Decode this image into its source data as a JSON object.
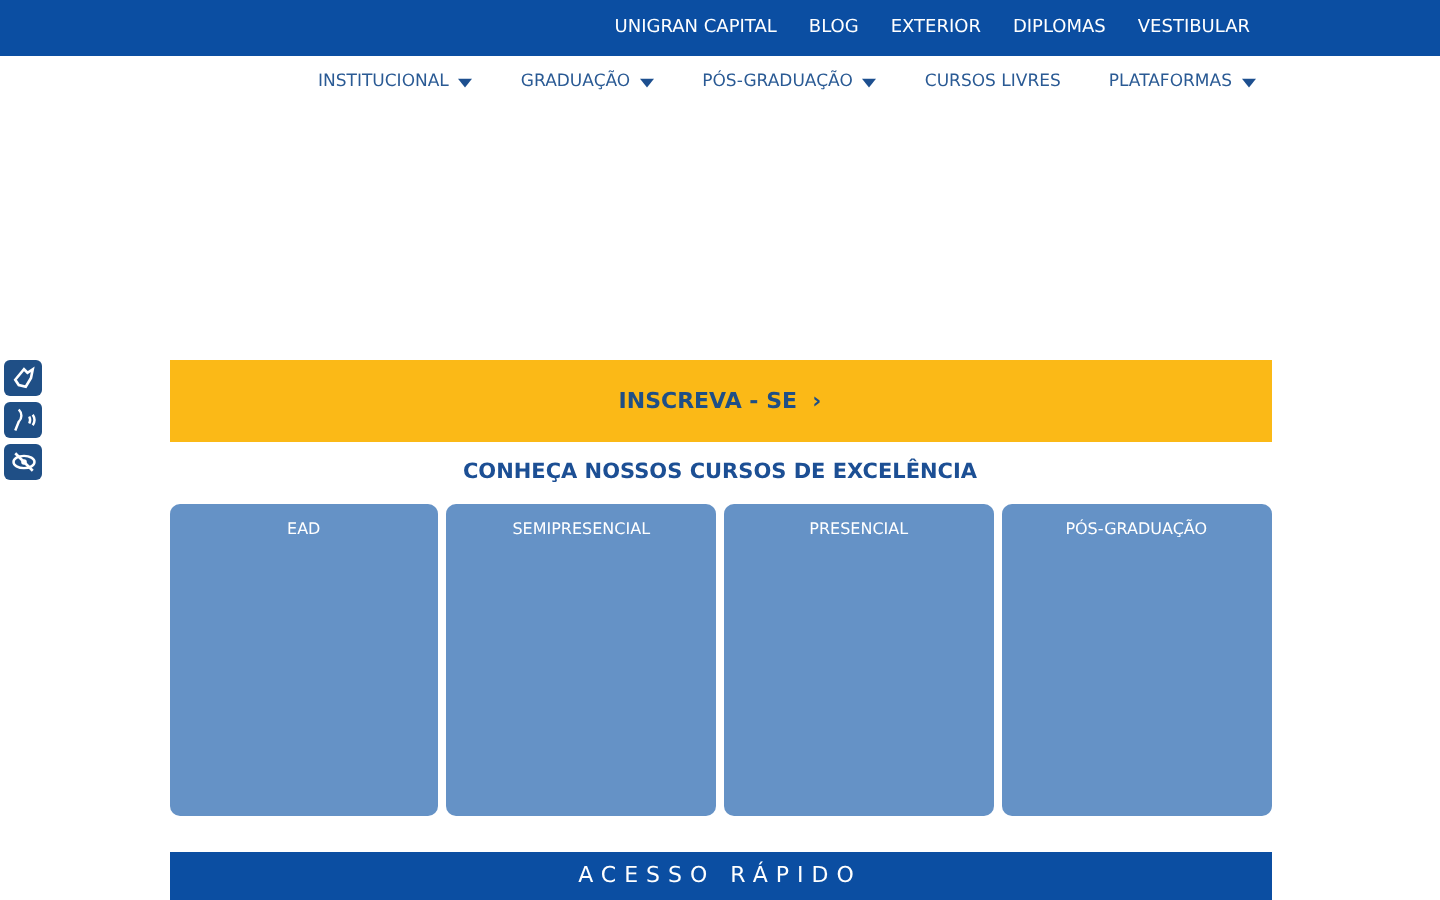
{
  "top_bar": {
    "links": [
      "UNIGRAN CAPITAL",
      "BLOG",
      "EXTERIOR",
      "DIPLOMAS",
      "VESTIBULAR"
    ]
  },
  "main_nav": [
    {
      "label": "INSTITUCIONAL",
      "has_menu": true
    },
    {
      "label": "GRADUAÇÃO",
      "has_menu": true
    },
    {
      "label": "PÓS-GRADUAÇÃO",
      "has_menu": true
    },
    {
      "label": "CURSOS LIVRES",
      "has_menu": false
    },
    {
      "label": "PLATAFORMAS",
      "has_menu": true
    }
  ],
  "accessibility_tools": [
    {
      "kind": "sign"
    },
    {
      "kind": "voice"
    },
    {
      "kind": "contrast"
    }
  ],
  "signup_banner": {
    "label": "INSCREVA - SE",
    "arrow": "›"
  },
  "courses": {
    "title": "CONHEÇA NOSSOS CURSOS DE EXCELÊNCIA",
    "cards": [
      "EAD",
      "SEMIPRESENCIAL",
      "PRESENCIAL",
      "PÓS-GRADUAÇÃO"
    ]
  },
  "quick_access": {
    "title": "ACESSO RÁPIDO"
  }
}
